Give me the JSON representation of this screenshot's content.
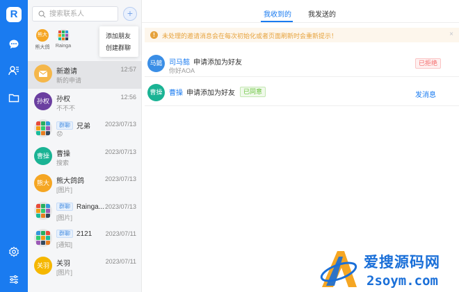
{
  "app": {
    "logo": "R"
  },
  "rail": {
    "icons": [
      "chat-icon",
      "contacts-icon",
      "folder-icon",
      "settings-icon",
      "sliders-icon"
    ]
  },
  "search": {
    "placeholder": "搜索联系人"
  },
  "add_button": {
    "label": "+"
  },
  "add_menu": {
    "items": [
      "添加朋友",
      "创建群聊"
    ]
  },
  "pinned": [
    {
      "avatar": "熊大",
      "label": "熊大鸽",
      "color": "#f5a623"
    },
    {
      "avatar": "",
      "label": "Rainga",
      "color": "#7ed321"
    }
  ],
  "conversations": [
    {
      "name": "新邀请",
      "preview": "新的申请",
      "time": "12:57",
      "avatar": "",
      "avatar_kind": "envelope",
      "color": "#f5b74a",
      "tag": ""
    },
    {
      "name": "孙权",
      "preview": "不不不",
      "time": "12:56",
      "avatar": "孙权",
      "avatar_kind": "text",
      "color": "#6b3fa0",
      "tag": ""
    },
    {
      "name": "兄弟",
      "preview": "😟",
      "time": "2023/07/13",
      "avatar": "",
      "avatar_kind": "grid",
      "color": "",
      "tag": "群聊"
    },
    {
      "name": "曹操",
      "preview": "搜索",
      "time": "2023/07/13",
      "avatar": "曹操",
      "avatar_kind": "text",
      "color": "#1ab394",
      "tag": ""
    },
    {
      "name": "熊大鸽鸽",
      "preview": "[图片]",
      "time": "2023/07/13",
      "avatar": "熊大",
      "avatar_kind": "text",
      "color": "#f5a623",
      "tag": ""
    },
    {
      "name": "Rainga...",
      "preview": "[图片]",
      "time": "2023/07/13",
      "avatar": "",
      "avatar_kind": "grid",
      "color": "",
      "tag": "群聊"
    },
    {
      "name": "2121",
      "preview": "[通知]",
      "time": "2023/07/11",
      "avatar": "",
      "avatar_kind": "grid",
      "color": "",
      "tag": "群聊"
    },
    {
      "name": "关羽",
      "preview": "[图片]",
      "time": "2023/07/11",
      "avatar": "关羽",
      "avatar_kind": "text",
      "color": "#f5b700",
      "tag": ""
    }
  ],
  "tabs": {
    "received": "我收到的",
    "sent": "我发送的",
    "active": "received"
  },
  "alert": {
    "icon": "!",
    "text": "未处理的邀请消息会在每次初始化或者页面刷新时会重新提示！",
    "close": "×"
  },
  "requests": [
    {
      "avatar": "马懿",
      "color": "#3a8ee6",
      "name": "司马懿",
      "action": "申请添加为好友",
      "message": "你好AOA",
      "status": "已拒绝",
      "status_kind": "rejected"
    },
    {
      "avatar": "曹操",
      "color": "#1ab394",
      "name": "曹操",
      "action": "申请添加为好友",
      "message": "",
      "status": "已同意",
      "status_kind": "accepted",
      "link": "发消息"
    }
  ],
  "watermark": {
    "line1": "爱搜源码网",
    "line2": "2soym.com"
  },
  "colors": {
    "primary": "#1a7bf0",
    "warning": "#e6a23c",
    "danger": "#f56c6c",
    "success": "#67c23a"
  }
}
